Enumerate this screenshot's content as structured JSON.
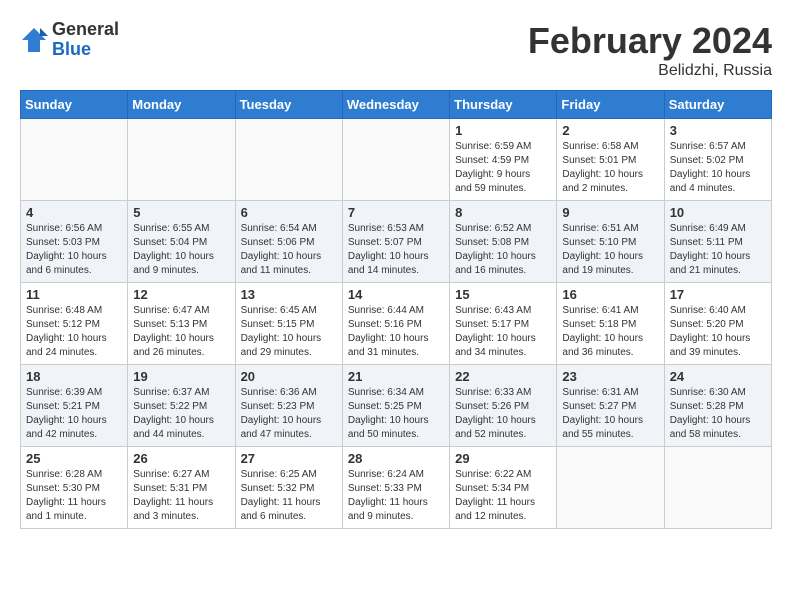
{
  "logo": {
    "general": "General",
    "blue": "Blue"
  },
  "title": "February 2024",
  "location": "Belidzhi, Russia",
  "days_of_week": [
    "Sunday",
    "Monday",
    "Tuesday",
    "Wednesday",
    "Thursday",
    "Friday",
    "Saturday"
  ],
  "weeks": [
    [
      {
        "day": "",
        "info": ""
      },
      {
        "day": "",
        "info": ""
      },
      {
        "day": "",
        "info": ""
      },
      {
        "day": "",
        "info": ""
      },
      {
        "day": "1",
        "info": "Sunrise: 6:59 AM\nSunset: 4:59 PM\nDaylight: 9 hours\nand 59 minutes."
      },
      {
        "day": "2",
        "info": "Sunrise: 6:58 AM\nSunset: 5:01 PM\nDaylight: 10 hours\nand 2 minutes."
      },
      {
        "day": "3",
        "info": "Sunrise: 6:57 AM\nSunset: 5:02 PM\nDaylight: 10 hours\nand 4 minutes."
      }
    ],
    [
      {
        "day": "4",
        "info": "Sunrise: 6:56 AM\nSunset: 5:03 PM\nDaylight: 10 hours\nand 6 minutes."
      },
      {
        "day": "5",
        "info": "Sunrise: 6:55 AM\nSunset: 5:04 PM\nDaylight: 10 hours\nand 9 minutes."
      },
      {
        "day": "6",
        "info": "Sunrise: 6:54 AM\nSunset: 5:06 PM\nDaylight: 10 hours\nand 11 minutes."
      },
      {
        "day": "7",
        "info": "Sunrise: 6:53 AM\nSunset: 5:07 PM\nDaylight: 10 hours\nand 14 minutes."
      },
      {
        "day": "8",
        "info": "Sunrise: 6:52 AM\nSunset: 5:08 PM\nDaylight: 10 hours\nand 16 minutes."
      },
      {
        "day": "9",
        "info": "Sunrise: 6:51 AM\nSunset: 5:10 PM\nDaylight: 10 hours\nand 19 minutes."
      },
      {
        "day": "10",
        "info": "Sunrise: 6:49 AM\nSunset: 5:11 PM\nDaylight: 10 hours\nand 21 minutes."
      }
    ],
    [
      {
        "day": "11",
        "info": "Sunrise: 6:48 AM\nSunset: 5:12 PM\nDaylight: 10 hours\nand 24 minutes."
      },
      {
        "day": "12",
        "info": "Sunrise: 6:47 AM\nSunset: 5:13 PM\nDaylight: 10 hours\nand 26 minutes."
      },
      {
        "day": "13",
        "info": "Sunrise: 6:45 AM\nSunset: 5:15 PM\nDaylight: 10 hours\nand 29 minutes."
      },
      {
        "day": "14",
        "info": "Sunrise: 6:44 AM\nSunset: 5:16 PM\nDaylight: 10 hours\nand 31 minutes."
      },
      {
        "day": "15",
        "info": "Sunrise: 6:43 AM\nSunset: 5:17 PM\nDaylight: 10 hours\nand 34 minutes."
      },
      {
        "day": "16",
        "info": "Sunrise: 6:41 AM\nSunset: 5:18 PM\nDaylight: 10 hours\nand 36 minutes."
      },
      {
        "day": "17",
        "info": "Sunrise: 6:40 AM\nSunset: 5:20 PM\nDaylight: 10 hours\nand 39 minutes."
      }
    ],
    [
      {
        "day": "18",
        "info": "Sunrise: 6:39 AM\nSunset: 5:21 PM\nDaylight: 10 hours\nand 42 minutes."
      },
      {
        "day": "19",
        "info": "Sunrise: 6:37 AM\nSunset: 5:22 PM\nDaylight: 10 hours\nand 44 minutes."
      },
      {
        "day": "20",
        "info": "Sunrise: 6:36 AM\nSunset: 5:23 PM\nDaylight: 10 hours\nand 47 minutes."
      },
      {
        "day": "21",
        "info": "Sunrise: 6:34 AM\nSunset: 5:25 PM\nDaylight: 10 hours\nand 50 minutes."
      },
      {
        "day": "22",
        "info": "Sunrise: 6:33 AM\nSunset: 5:26 PM\nDaylight: 10 hours\nand 52 minutes."
      },
      {
        "day": "23",
        "info": "Sunrise: 6:31 AM\nSunset: 5:27 PM\nDaylight: 10 hours\nand 55 minutes."
      },
      {
        "day": "24",
        "info": "Sunrise: 6:30 AM\nSunset: 5:28 PM\nDaylight: 10 hours\nand 58 minutes."
      }
    ],
    [
      {
        "day": "25",
        "info": "Sunrise: 6:28 AM\nSunset: 5:30 PM\nDaylight: 11 hours\nand 1 minute."
      },
      {
        "day": "26",
        "info": "Sunrise: 6:27 AM\nSunset: 5:31 PM\nDaylight: 11 hours\nand 3 minutes."
      },
      {
        "day": "27",
        "info": "Sunrise: 6:25 AM\nSunset: 5:32 PM\nDaylight: 11 hours\nand 6 minutes."
      },
      {
        "day": "28",
        "info": "Sunrise: 6:24 AM\nSunset: 5:33 PM\nDaylight: 11 hours\nand 9 minutes."
      },
      {
        "day": "29",
        "info": "Sunrise: 6:22 AM\nSunset: 5:34 PM\nDaylight: 11 hours\nand 12 minutes."
      },
      {
        "day": "",
        "info": ""
      },
      {
        "day": "",
        "info": ""
      }
    ]
  ]
}
